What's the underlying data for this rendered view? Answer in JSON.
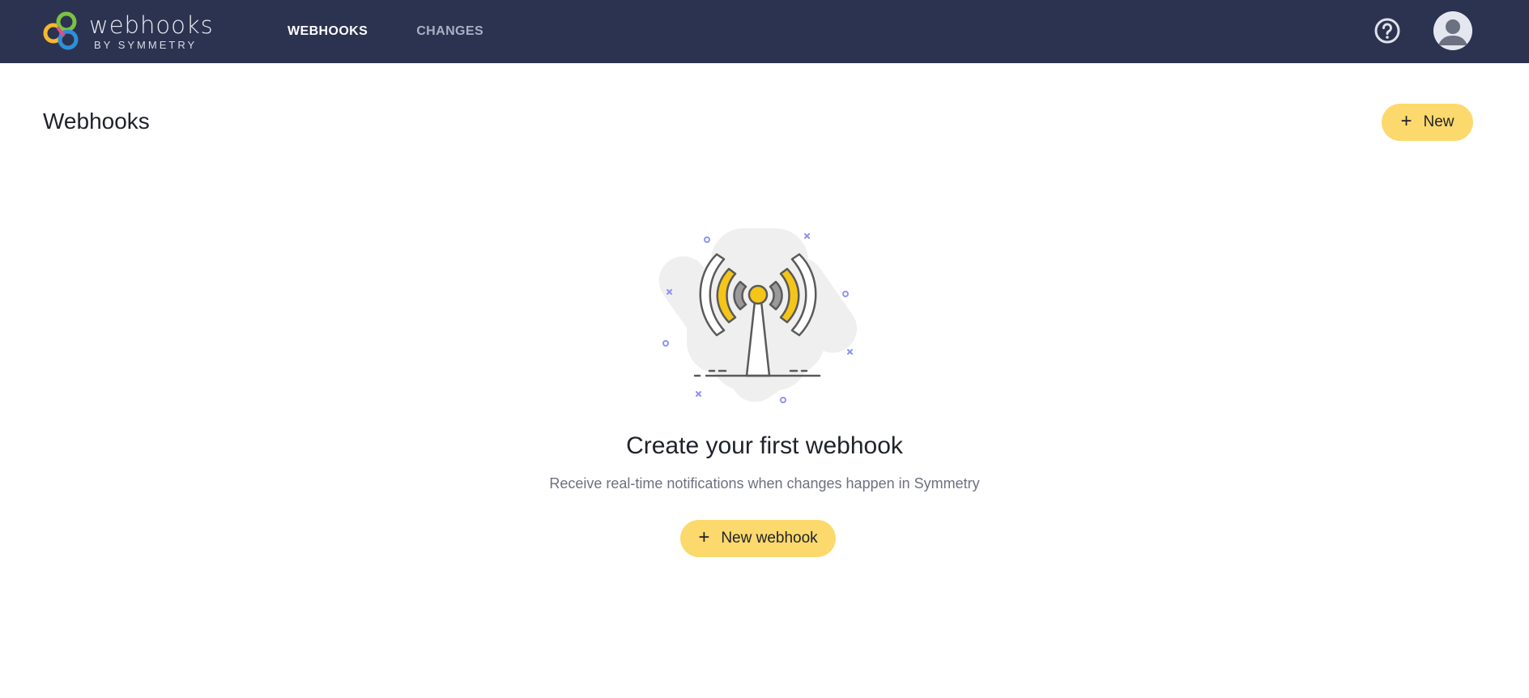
{
  "brand": {
    "name": "webhooks",
    "subtitle": "BY SYMMETRY",
    "logo_icon": "webhooks-logo-icon"
  },
  "nav": {
    "items": [
      {
        "label": "WEBHOOKS",
        "active": true
      },
      {
        "label": "CHANGES",
        "active": false
      }
    ]
  },
  "header_actions": {
    "help_icon": "help-circle-icon",
    "avatar_icon": "user-avatar-icon"
  },
  "page": {
    "title": "Webhooks",
    "new_button_label": "New"
  },
  "empty_state": {
    "illustration": "radio-tower-icon",
    "title": "Create your first webhook",
    "description": "Receive real-time notifications when changes happen in Symmetry",
    "button_label": "New webhook"
  },
  "colors": {
    "topbar": "#2c3350",
    "accent_yellow": "#fcd96c",
    "illustration_yellow": "#f5c518",
    "decor_blue": "#8c93f5"
  }
}
